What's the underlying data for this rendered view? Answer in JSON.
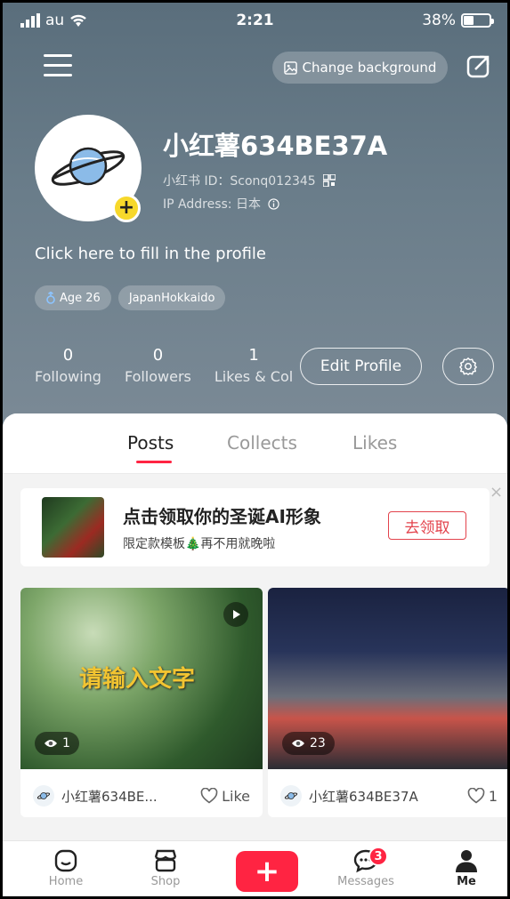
{
  "status_bar": {
    "carrier": "au",
    "time": "2:21",
    "battery": "38%",
    "battery_level": 0.38
  },
  "header": {
    "change_background_label": "Change background",
    "username": "小红薯634BE37A",
    "user_id": "小红书 ID：Sconq012345",
    "ip_address": "IP Address: 日本",
    "bio_prompt": "Click here to fill in the profile",
    "tags": [
      {
        "label": "Age 26",
        "icon": "male-icon"
      },
      {
        "label": "JapanHokkaido"
      }
    ],
    "stats": [
      {
        "value": "0",
        "label": "Following"
      },
      {
        "value": "0",
        "label": "Followers"
      },
      {
        "value": "1",
        "label": "Likes & Col"
      }
    ],
    "edit_profile_label": "Edit Profile"
  },
  "tabs": [
    {
      "label": "Posts",
      "active": true
    },
    {
      "label": "Collects",
      "active": false
    },
    {
      "label": "Likes",
      "active": false
    }
  ],
  "promo": {
    "title": "点击领取你的圣诞AI形象",
    "subtitle": "限定款模板🎄再不用就晚啦",
    "button_label": "去领取",
    "close": "×"
  },
  "posts": [
    {
      "overlay_text": "请输入文字",
      "views": "1",
      "author": "小红薯634BE...",
      "like_label": "Like",
      "is_video": true
    },
    {
      "views": "23",
      "author": "小红薯634BE37A",
      "like_label": "1",
      "is_video": false
    }
  ],
  "bottom_nav": {
    "items": [
      {
        "label": "Home"
      },
      {
        "label": "Shop"
      },
      {
        "label": "+"
      },
      {
        "label": "Messages",
        "badge": "3"
      },
      {
        "label": "Me"
      }
    ]
  },
  "colors": {
    "accent": "#ff2442",
    "header_bg": "#667a87",
    "promo_red": "#e3434c",
    "yellow": "#f7d82b"
  }
}
